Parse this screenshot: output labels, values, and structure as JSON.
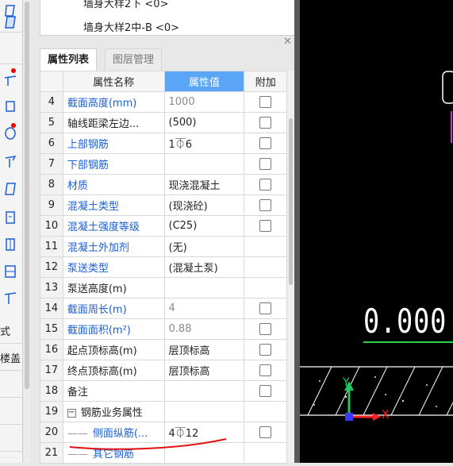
{
  "top_items": [
    "墙身大样2下 <0>",
    "墙身大样2中-B <0>"
  ],
  "tabs": [
    "属性列表",
    "图层管理"
  ],
  "columns": [
    "属性名称",
    "属性值",
    "附加"
  ],
  "rows": [
    {
      "num": "4",
      "name": "截面高度(mm)",
      "value": "1000",
      "name_blue": true,
      "value_gray": true,
      "checkbox": true
    },
    {
      "num": "5",
      "name": "轴线距梁左边...",
      "value": "(500)",
      "name_blue": false,
      "value_gray": false,
      "checkbox": true
    },
    {
      "num": "6",
      "name": "上部钢筋",
      "value": "1⏁6",
      "name_blue": true,
      "value_gray": false,
      "checkbox": true
    },
    {
      "num": "7",
      "name": "下部钢筋",
      "value": "",
      "name_blue": true,
      "value_gray": false,
      "checkbox": true
    },
    {
      "num": "8",
      "name": "材质",
      "value": "现浇混凝土",
      "name_blue": true,
      "value_gray": false,
      "checkbox": true
    },
    {
      "num": "9",
      "name": "混凝土类型",
      "value": "(现浇砼)",
      "name_blue": true,
      "value_gray": false,
      "checkbox": true
    },
    {
      "num": "10",
      "name": "混凝土强度等级",
      "value": "(C25)",
      "name_blue": true,
      "value_gray": false,
      "checkbox": true
    },
    {
      "num": "11",
      "name": "混凝土外加剂",
      "value": "(无)",
      "name_blue": true,
      "value_gray": false,
      "checkbox": false
    },
    {
      "num": "12",
      "name": "泵送类型",
      "value": "(混凝土泵)",
      "name_blue": true,
      "value_gray": false,
      "checkbox": false
    },
    {
      "num": "13",
      "name": "泵送高度(m)",
      "value": "",
      "name_blue": false,
      "value_gray": false,
      "checkbox": false
    },
    {
      "num": "14",
      "name": "截面周长(m)",
      "value": "4",
      "name_blue": true,
      "value_gray": true,
      "checkbox": true
    },
    {
      "num": "15",
      "name": "截面面积(m²)",
      "value": "0.88",
      "name_blue": true,
      "value_gray": true,
      "checkbox": true
    },
    {
      "num": "16",
      "name": "起点顶标高(m)",
      "value": "层顶标高",
      "name_blue": false,
      "value_gray": false,
      "checkbox": true
    },
    {
      "num": "17",
      "name": "终点顶标高(m)",
      "value": "层顶标高",
      "name_blue": false,
      "value_gray": false,
      "checkbox": true
    },
    {
      "num": "18",
      "name": "备注",
      "value": "",
      "name_blue": false,
      "value_gray": false,
      "checkbox": true
    },
    {
      "num": "19",
      "name": "钢筋业务属性",
      "value": "",
      "name_blue": false,
      "value_gray": false,
      "checkbox": false,
      "group": true
    },
    {
      "num": "20",
      "name": "侧面纵筋(...",
      "value": "4⏁12",
      "name_blue": true,
      "value_gray": false,
      "checkbox": true,
      "child": true
    },
    {
      "num": "21",
      "name": "其它钢筋",
      "value": "",
      "name_blue": true,
      "value_gray": false,
      "checkbox": false,
      "child": true
    }
  ],
  "left_toolbar": {
    "text1": "式",
    "text2": "楼盖"
  },
  "canvas": {
    "elevation": "0.000",
    "axis_y": "Y",
    "axis_x": "X"
  },
  "colors": {
    "header_accent": "#5aa5f5",
    "link_blue": "#1a5fd6",
    "annotation_red": "#e01010",
    "axis_green": "#22c55e",
    "axis_red": "#ff2020"
  }
}
